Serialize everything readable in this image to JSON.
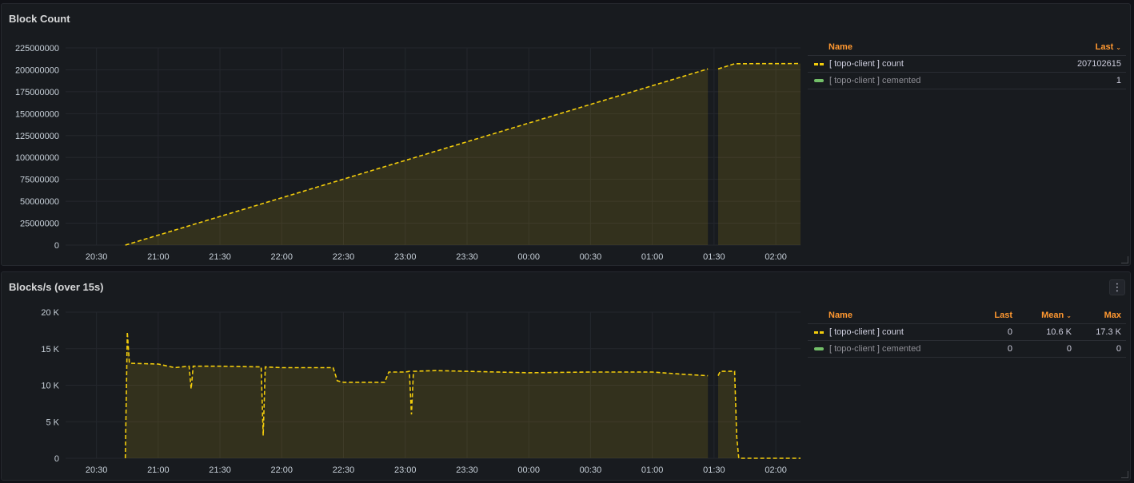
{
  "panels": [
    {
      "title": "Block Count",
      "legend": {
        "headers": {
          "name": "Name",
          "last": "Last"
        },
        "rows": [
          {
            "name": "[ topo-client ] count",
            "last": "207102615",
            "style": "dash"
          },
          {
            "name": "[ topo-client ] cemented",
            "last": "1",
            "style": "green"
          }
        ]
      }
    },
    {
      "title": "Blocks/s (over 15s)",
      "legend": {
        "headers": {
          "name": "Name",
          "last": "Last",
          "mean": "Mean",
          "max": "Max"
        },
        "rows": [
          {
            "name": "[ topo-client ] count",
            "last": "0",
            "mean": "10.6 K",
            "max": "17.3 K",
            "style": "dash"
          },
          {
            "name": "[ topo-client ] cemented",
            "last": "0",
            "mean": "0",
            "max": "0",
            "style": "green"
          }
        ]
      }
    }
  ],
  "colors": {
    "series": "#f2cc0c",
    "cemented": "#73bf69",
    "header": "#ff9830"
  },
  "chart_data": [
    {
      "type": "area",
      "title": "Block Count",
      "x_ticks": [
        "20:30",
        "21:00",
        "21:30",
        "22:00",
        "22:30",
        "23:00",
        "23:30",
        "00:00",
        "00:30",
        "01:00",
        "01:30",
        "02:00"
      ],
      "y_ticks": [
        "0",
        "25000000",
        "50000000",
        "75000000",
        "100000000",
        "125000000",
        "150000000",
        "175000000",
        "200000000",
        "225000000"
      ],
      "ylim": [
        0,
        225000000
      ],
      "x_range_hours": [
        "20:15",
        "02:12"
      ],
      "series": [
        {
          "name": "[ topo-client ] count",
          "x": [
            "20:44",
            "01:27",
            "01:32",
            "01:36",
            "01:40",
            "02:12"
          ],
          "values": [
            0,
            201000000,
            201000000,
            204000000,
            207000000,
            207102615
          ],
          "gaps": [
            [
              "01:27",
              "01:32"
            ]
          ]
        },
        {
          "name": "[ topo-client ] cemented",
          "x": [
            "20:44",
            "02:12"
          ],
          "values": [
            1,
            1
          ]
        }
      ]
    },
    {
      "type": "area",
      "title": "Blocks/s (over 15s)",
      "x_ticks": [
        "20:30",
        "21:00",
        "21:30",
        "22:00",
        "22:30",
        "23:00",
        "23:30",
        "00:00",
        "00:30",
        "01:00",
        "01:30",
        "02:00"
      ],
      "y_ticks": [
        "0",
        "5 K",
        "10 K",
        "15 K",
        "20 K"
      ],
      "ylim": [
        0,
        20000
      ],
      "series": [
        {
          "name": "[ topo-client ] count",
          "x": [
            "20:44",
            "20:45",
            "20:46",
            "21:00",
            "21:08",
            "21:15",
            "21:16",
            "21:17",
            "21:30",
            "21:50",
            "21:51",
            "21:52",
            "22:00",
            "22:25",
            "22:27",
            "22:30",
            "22:45",
            "22:50",
            "22:52",
            "23:00",
            "23:02",
            "23:03",
            "23:04",
            "23:15",
            "23:30",
            "00:00",
            "00:30",
            "01:00",
            "01:15",
            "01:27",
            "01:32",
            "01:33",
            "01:40",
            "01:41",
            "01:42",
            "02:12"
          ],
          "values": [
            0,
            17300,
            13000,
            12900,
            12400,
            12600,
            9500,
            12600,
            12600,
            12500,
            3100,
            12500,
            12400,
            12400,
            10600,
            10400,
            10400,
            10400,
            11800,
            11800,
            11900,
            6000,
            11900,
            12000,
            11900,
            11700,
            11800,
            11800,
            11500,
            11300,
            11300,
            11900,
            11900,
            3000,
            0,
            0
          ],
          "gaps": [
            [
              "01:27",
              "01:32"
            ]
          ]
        },
        {
          "name": "[ topo-client ] cemented",
          "x": [
            "20:44",
            "02:12"
          ],
          "values": [
            0,
            0
          ]
        }
      ]
    }
  ]
}
